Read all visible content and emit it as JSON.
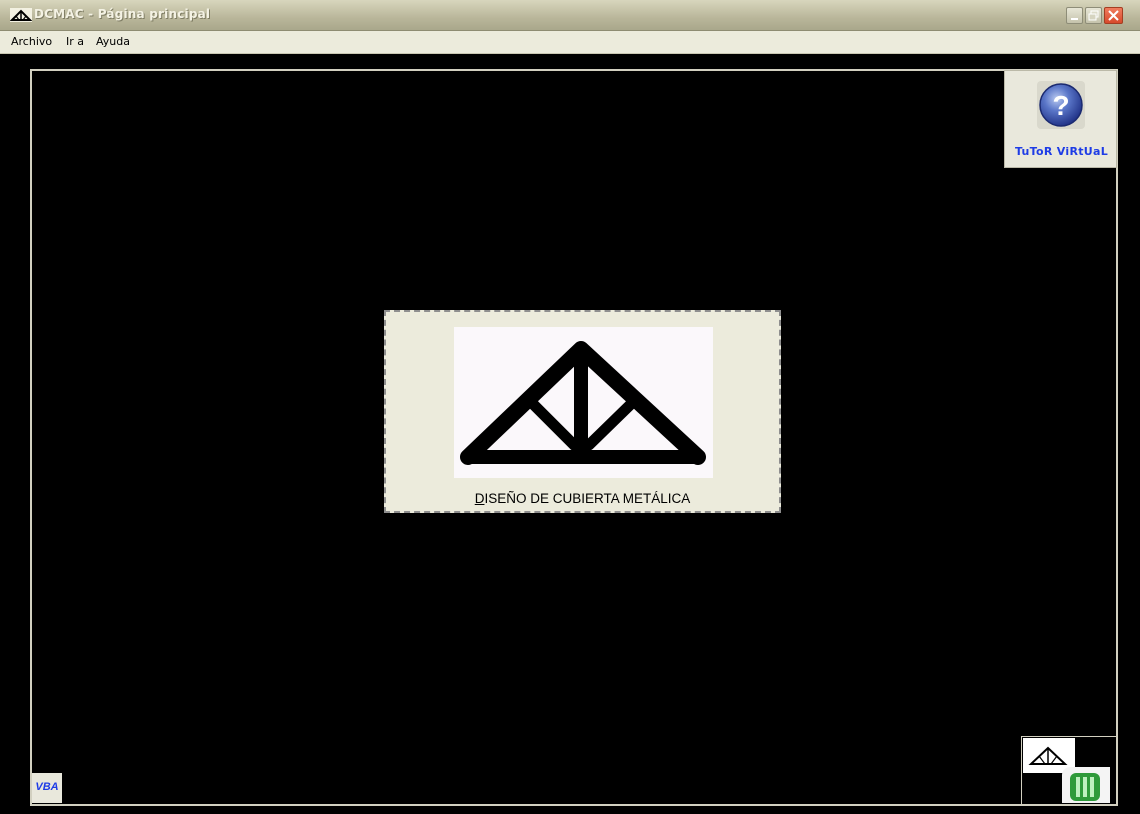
{
  "window": {
    "title": "DCMAC - Página principal"
  },
  "menu": {
    "items": [
      "Archivo",
      "Ir a",
      "Ayuda"
    ]
  },
  "tutor": {
    "label": "TuToR ViRtUaL",
    "icon": "help-question-icon"
  },
  "card": {
    "label": "DISEÑO DE CUBIERTA METÁLICA",
    "icon": "roof-truss-icon"
  },
  "vba": {
    "label": "VBA"
  },
  "logo": {
    "icon": "dcmac-logo-icon"
  },
  "colors": {
    "background": "#000000",
    "titlebar": "#b9b69a",
    "menubar": "#ecebdc",
    "accent_text": "#1e3ce6"
  }
}
